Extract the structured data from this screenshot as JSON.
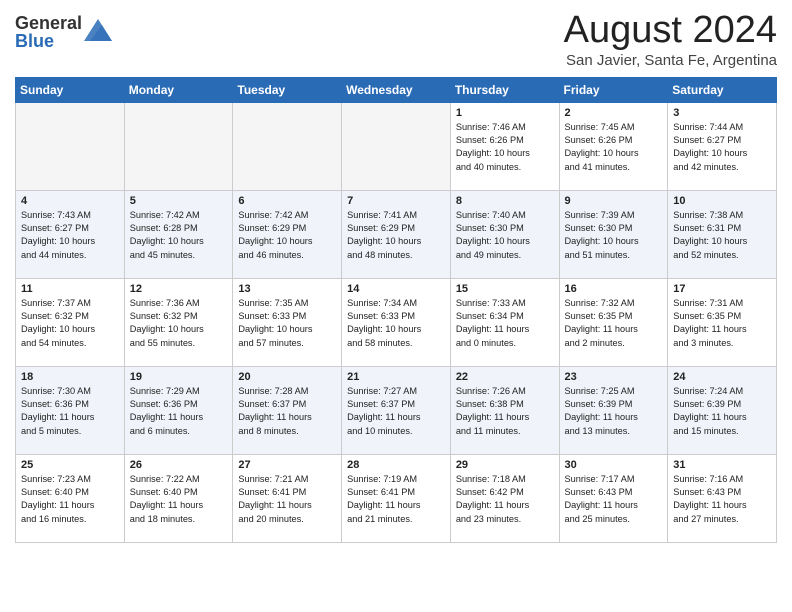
{
  "header": {
    "logo_general": "General",
    "logo_blue": "Blue",
    "month_title": "August 2024",
    "location": "San Javier, Santa Fe, Argentina"
  },
  "calendar": {
    "weekdays": [
      "Sunday",
      "Monday",
      "Tuesday",
      "Wednesday",
      "Thursday",
      "Friday",
      "Saturday"
    ],
    "weeks": [
      [
        {
          "day": "",
          "info": ""
        },
        {
          "day": "",
          "info": ""
        },
        {
          "day": "",
          "info": ""
        },
        {
          "day": "",
          "info": ""
        },
        {
          "day": "1",
          "info": "Sunrise: 7:46 AM\nSunset: 6:26 PM\nDaylight: 10 hours\nand 40 minutes."
        },
        {
          "day": "2",
          "info": "Sunrise: 7:45 AM\nSunset: 6:26 PM\nDaylight: 10 hours\nand 41 minutes."
        },
        {
          "day": "3",
          "info": "Sunrise: 7:44 AM\nSunset: 6:27 PM\nDaylight: 10 hours\nand 42 minutes."
        }
      ],
      [
        {
          "day": "4",
          "info": "Sunrise: 7:43 AM\nSunset: 6:27 PM\nDaylight: 10 hours\nand 44 minutes."
        },
        {
          "day": "5",
          "info": "Sunrise: 7:42 AM\nSunset: 6:28 PM\nDaylight: 10 hours\nand 45 minutes."
        },
        {
          "day": "6",
          "info": "Sunrise: 7:42 AM\nSunset: 6:29 PM\nDaylight: 10 hours\nand 46 minutes."
        },
        {
          "day": "7",
          "info": "Sunrise: 7:41 AM\nSunset: 6:29 PM\nDaylight: 10 hours\nand 48 minutes."
        },
        {
          "day": "8",
          "info": "Sunrise: 7:40 AM\nSunset: 6:30 PM\nDaylight: 10 hours\nand 49 minutes."
        },
        {
          "day": "9",
          "info": "Sunrise: 7:39 AM\nSunset: 6:30 PM\nDaylight: 10 hours\nand 51 minutes."
        },
        {
          "day": "10",
          "info": "Sunrise: 7:38 AM\nSunset: 6:31 PM\nDaylight: 10 hours\nand 52 minutes."
        }
      ],
      [
        {
          "day": "11",
          "info": "Sunrise: 7:37 AM\nSunset: 6:32 PM\nDaylight: 10 hours\nand 54 minutes."
        },
        {
          "day": "12",
          "info": "Sunrise: 7:36 AM\nSunset: 6:32 PM\nDaylight: 10 hours\nand 55 minutes."
        },
        {
          "day": "13",
          "info": "Sunrise: 7:35 AM\nSunset: 6:33 PM\nDaylight: 10 hours\nand 57 minutes."
        },
        {
          "day": "14",
          "info": "Sunrise: 7:34 AM\nSunset: 6:33 PM\nDaylight: 10 hours\nand 58 minutes."
        },
        {
          "day": "15",
          "info": "Sunrise: 7:33 AM\nSunset: 6:34 PM\nDaylight: 11 hours\nand 0 minutes."
        },
        {
          "day": "16",
          "info": "Sunrise: 7:32 AM\nSunset: 6:35 PM\nDaylight: 11 hours\nand 2 minutes."
        },
        {
          "day": "17",
          "info": "Sunrise: 7:31 AM\nSunset: 6:35 PM\nDaylight: 11 hours\nand 3 minutes."
        }
      ],
      [
        {
          "day": "18",
          "info": "Sunrise: 7:30 AM\nSunset: 6:36 PM\nDaylight: 11 hours\nand 5 minutes."
        },
        {
          "day": "19",
          "info": "Sunrise: 7:29 AM\nSunset: 6:36 PM\nDaylight: 11 hours\nand 6 minutes."
        },
        {
          "day": "20",
          "info": "Sunrise: 7:28 AM\nSunset: 6:37 PM\nDaylight: 11 hours\nand 8 minutes."
        },
        {
          "day": "21",
          "info": "Sunrise: 7:27 AM\nSunset: 6:37 PM\nDaylight: 11 hours\nand 10 minutes."
        },
        {
          "day": "22",
          "info": "Sunrise: 7:26 AM\nSunset: 6:38 PM\nDaylight: 11 hours\nand 11 minutes."
        },
        {
          "day": "23",
          "info": "Sunrise: 7:25 AM\nSunset: 6:39 PM\nDaylight: 11 hours\nand 13 minutes."
        },
        {
          "day": "24",
          "info": "Sunrise: 7:24 AM\nSunset: 6:39 PM\nDaylight: 11 hours\nand 15 minutes."
        }
      ],
      [
        {
          "day": "25",
          "info": "Sunrise: 7:23 AM\nSunset: 6:40 PM\nDaylight: 11 hours\nand 16 minutes."
        },
        {
          "day": "26",
          "info": "Sunrise: 7:22 AM\nSunset: 6:40 PM\nDaylight: 11 hours\nand 18 minutes."
        },
        {
          "day": "27",
          "info": "Sunrise: 7:21 AM\nSunset: 6:41 PM\nDaylight: 11 hours\nand 20 minutes."
        },
        {
          "day": "28",
          "info": "Sunrise: 7:19 AM\nSunset: 6:41 PM\nDaylight: 11 hours\nand 21 minutes."
        },
        {
          "day": "29",
          "info": "Sunrise: 7:18 AM\nSunset: 6:42 PM\nDaylight: 11 hours\nand 23 minutes."
        },
        {
          "day": "30",
          "info": "Sunrise: 7:17 AM\nSunset: 6:43 PM\nDaylight: 11 hours\nand 25 minutes."
        },
        {
          "day": "31",
          "info": "Sunrise: 7:16 AM\nSunset: 6:43 PM\nDaylight: 11 hours\nand 27 minutes."
        }
      ]
    ]
  }
}
